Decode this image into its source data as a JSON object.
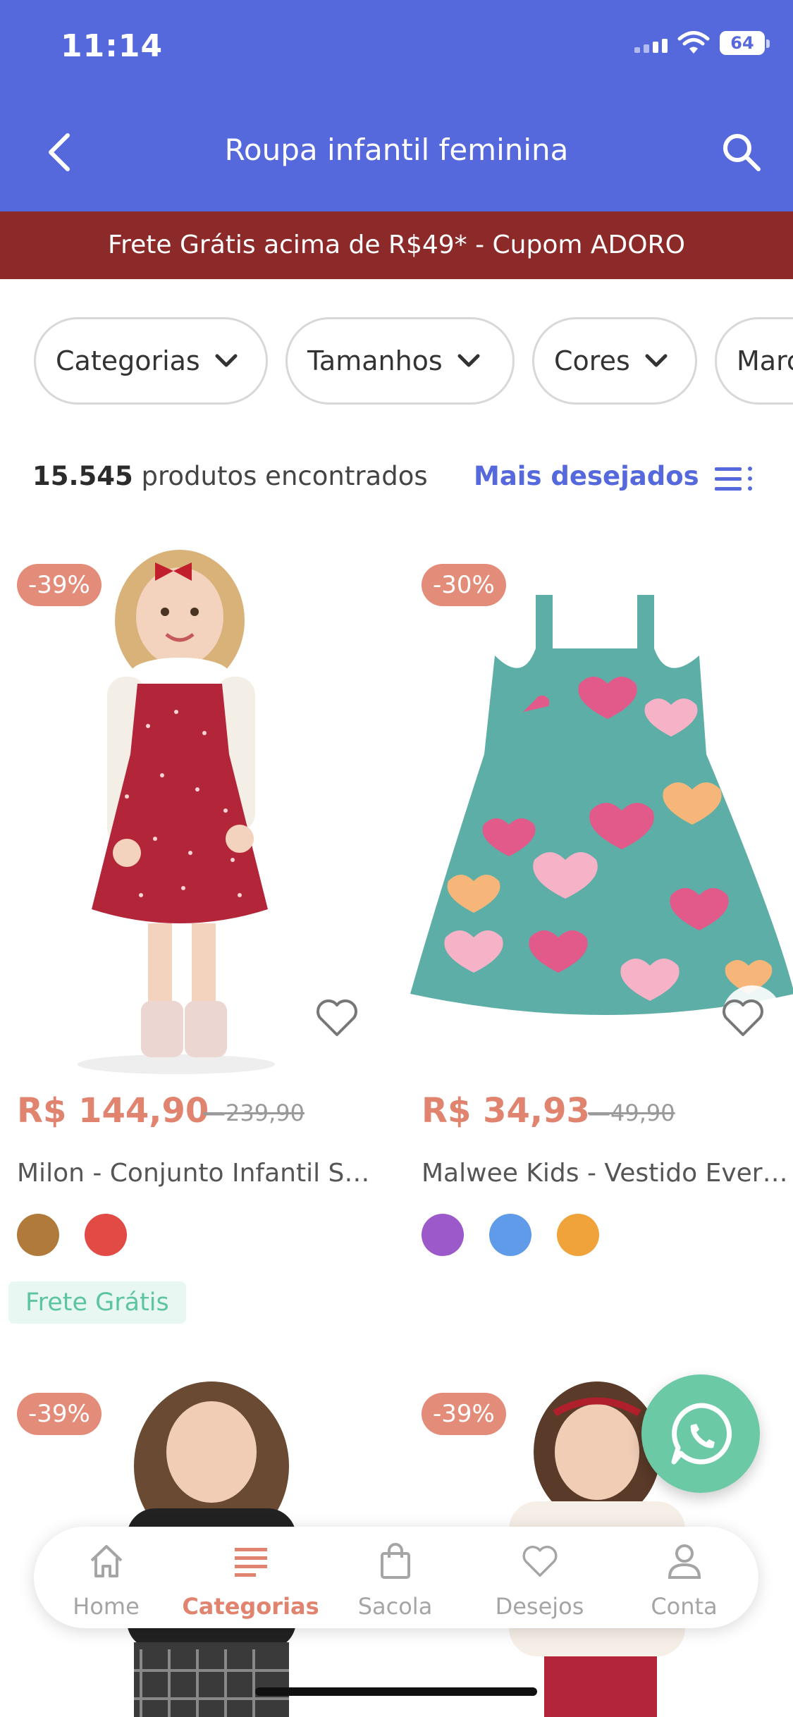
{
  "status": {
    "time": "11:14",
    "battery": "64"
  },
  "header": {
    "title": "Roupa infantil feminina"
  },
  "promo": {
    "text": "Frete Grátis acima de R$49* - Cupom ADORO"
  },
  "filters": [
    "Categorias",
    "Tamanhos",
    "Cores",
    "Marcas"
  ],
  "results": {
    "count": "15.545",
    "label": " produtos encontrados",
    "sort": "Mais desejados"
  },
  "products": [
    {
      "discount": "-39%",
      "price": "R$ 144,90",
      "old_price": "239,90",
      "name": "Milon - Conjunto Infantil Salopete",
      "colors": [
        "#B07A3A",
        "#E24B45"
      ],
      "tag": "Frete Grátis"
    },
    {
      "discount": "-30%",
      "price": "R$ 34,93",
      "old_price": "49,90",
      "name": "Malwee Kids - Vestido Everyday",
      "colors": [
        "#9B59C9",
        "#5F9BE8",
        "#F0A33B"
      ]
    },
    {
      "discount": "-39%"
    },
    {
      "discount": "-39%"
    }
  ],
  "nav": [
    {
      "label": "Home",
      "icon": "home-icon"
    },
    {
      "label": "Categorias",
      "icon": "list-icon",
      "active": true
    },
    {
      "label": "Sacola",
      "icon": "bag-icon"
    },
    {
      "label": "Desejos",
      "icon": "heart-icon"
    },
    {
      "label": "Conta",
      "icon": "user-icon"
    }
  ],
  "colors": {
    "primary": "#5568DC",
    "promo": "#8C2A2A",
    "accent": "#E1846F",
    "free_shipping": "#5DC4A3",
    "whatsapp": "#6CC9A6"
  }
}
